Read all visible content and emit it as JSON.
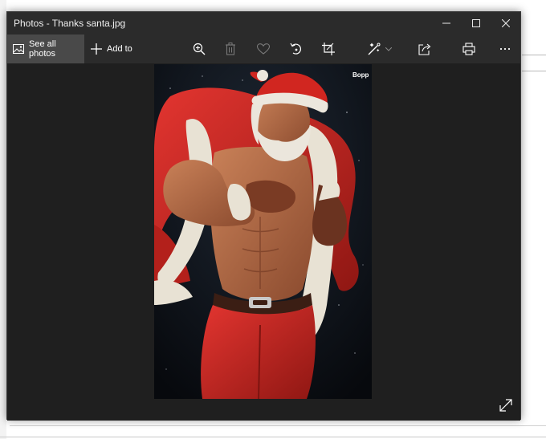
{
  "window": {
    "title": "Photos - Thanks santa.jpg",
    "controls": [
      "minimize",
      "maximize",
      "close"
    ]
  },
  "toolbar": {
    "see_all_label": "See all photos",
    "add_to_label": "Add to",
    "icons": [
      "zoom-in-icon",
      "delete-icon",
      "favorite-icon",
      "rotate-icon",
      "crop-icon",
      "edit-icon",
      "share-icon",
      "print-icon",
      "more-icon"
    ]
  },
  "photo": {
    "watermark": "Bopp"
  },
  "colors": {
    "titlebar": "#2b2b2b",
    "background": "#1f1f1f",
    "see_all_active": "#494949"
  }
}
